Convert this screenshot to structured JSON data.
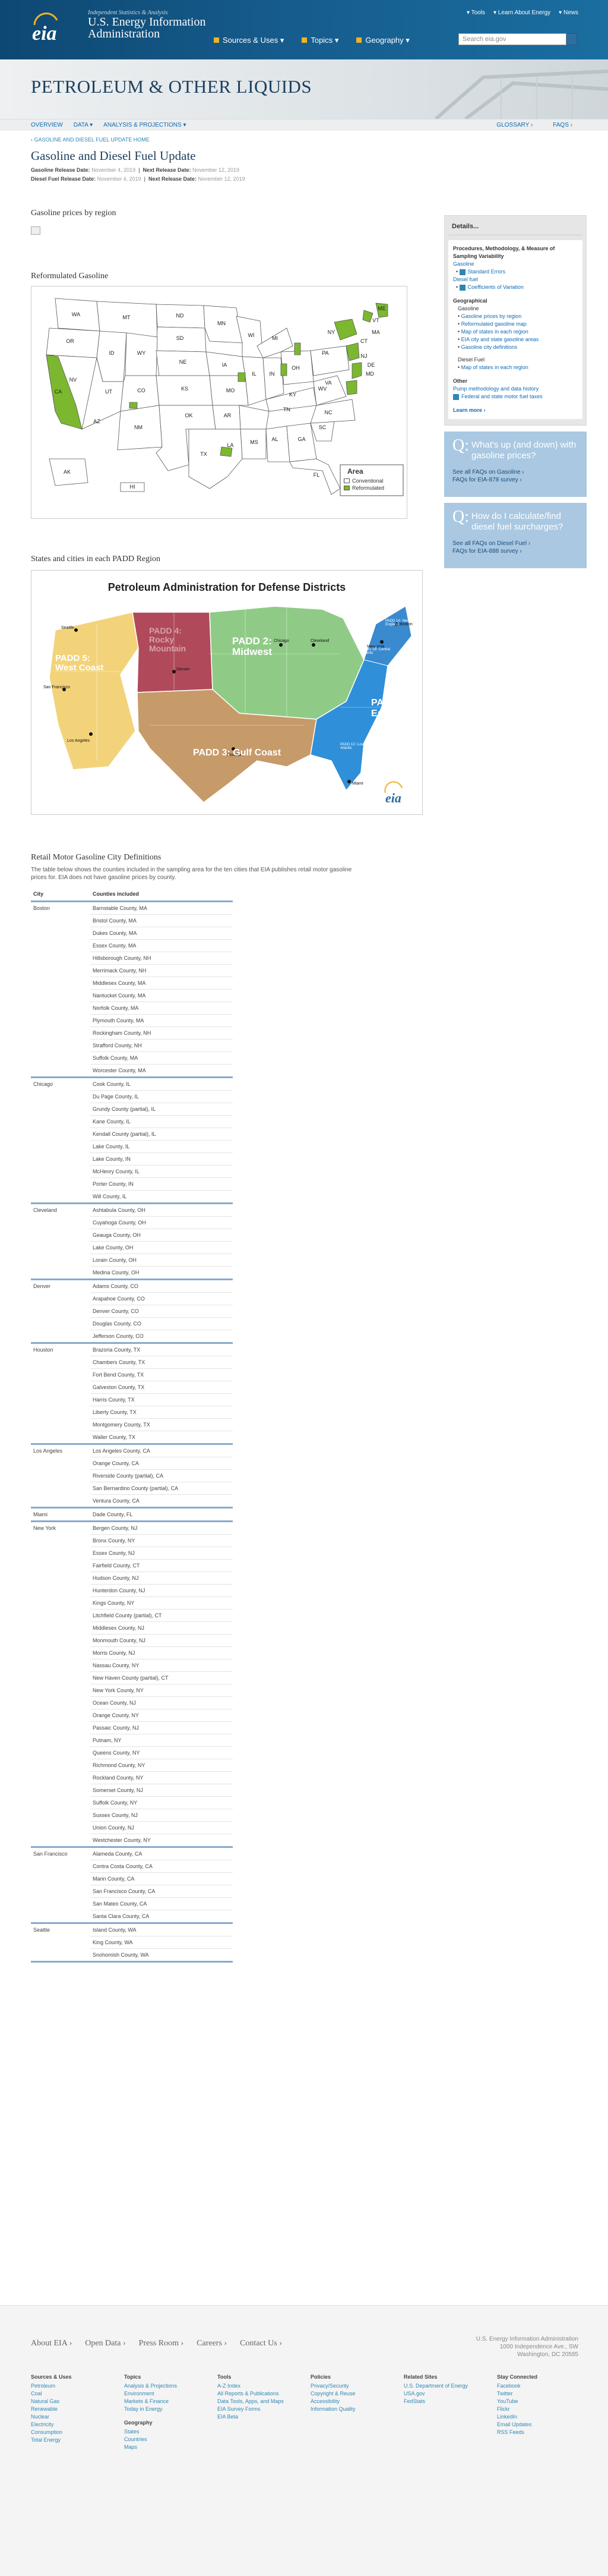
{
  "header": {
    "logo_text": "eia",
    "tagline": "Independent Statistics & Analysis",
    "org_line1": "U.S. Energy Information",
    "org_line2": "Administration",
    "top_links": [
      "Tools",
      "Learn About Energy",
      "News"
    ],
    "nav": [
      "Sources & Uses",
      "Topics",
      "Geography"
    ],
    "search_placeholder": "Search eia.gov"
  },
  "band": {
    "title": "PETROLEUM & OTHER LIQUIDS"
  },
  "subnav": {
    "left": [
      "OVERVIEW",
      "DATA",
      "ANALYSIS & PROJECTIONS"
    ],
    "right": [
      "GLOSSARY",
      "FAQS"
    ]
  },
  "page": {
    "breadcrumb": "‹ GASOLINE AND DIESEL FUEL UPDATE HOME",
    "title": "Gasoline and Diesel Fuel Update",
    "rel1_label": "Gasoline Release Date:",
    "rel1_val": "November 4, 2019",
    "rel1_next_label": "Next Release Date:",
    "rel1_next_val": "November 12, 2019",
    "rel2_label": "Diesel Fuel Release Date:",
    "rel2_val": "November 4, 2019",
    "rel2_next_label": "Next Release Date:",
    "rel2_next_val": "November 12, 2019",
    "sec1": "Gasoline prices by region",
    "sec2": "Reformulated Gasoline",
    "sec3": "States and cities in each PADD Region",
    "sec4": "Retail Motor Gasoline City Definitions",
    "sec4_desc": "The table below shows the counties included in the sampling area for the ten cities that EIA publishes retail motor gasoline prices for. EIA does not have gasoline prices by county."
  },
  "rfg_map": {
    "legend_title": "Area",
    "legend_conv": "Conventional",
    "legend_rfg": "Reformulated",
    "states": [
      "WA",
      "MT",
      "ND",
      "MN",
      "OR",
      "ID",
      "SD",
      "WI",
      "MI",
      "NY",
      "VT",
      "ME",
      "WY",
      "NE",
      "IA",
      "PA",
      "NV",
      "UT",
      "CO",
      "KS",
      "MO",
      "IL",
      "IN",
      "OH",
      "CA",
      "AZ",
      "NM",
      "OK",
      "AR",
      "TN",
      "KY",
      "WV",
      "VA",
      "NC",
      "TX",
      "LA",
      "MS",
      "AL",
      "GA",
      "SC",
      "FL",
      "AK",
      "HI",
      "NH",
      "MA",
      "CT",
      "RI",
      "NJ",
      "DE",
      "MD",
      "DC"
    ]
  },
  "padd_map": {
    "title": "Petroleum Administration for Defense Districts",
    "p1": "PADD 1:",
    "p1b": "East Coast",
    "p1a": "PADD 1A: New England",
    "p1bz": "PADD 1B: Central Atlantic",
    "p1c": "PADD 1C: Lower Atlantic",
    "p2": "PADD 2:",
    "p2b": "Midwest",
    "p3": "PADD 3: Gulf Coast",
    "p4": "PADD 4:",
    "p4b": "Rocky",
    "p4c": "Mountain",
    "p5": "PADD 5:",
    "p5b": "West Coast",
    "logo": "eia",
    "cities": [
      "San Francisco",
      "Los Angeles",
      "Seattle",
      "Denver",
      "Chicago",
      "Cleveland",
      "Boston",
      "New York",
      "Houston",
      "Miami"
    ]
  },
  "table": {
    "headers": [
      "City",
      "Counties included"
    ],
    "rows": [
      {
        "city": "Boston",
        "counties": [
          "Barnstable County, MA",
          "Bristol County, MA",
          "Dukes County, MA",
          "Essex County, MA",
          "Hillsborough County, NH",
          "Merrimack County, NH",
          "Middlesex County, MA",
          "Nantucket County, MA",
          "Norfolk County, MA",
          "Plymouth County, MA",
          "Rockingham County, NH",
          "Strafford County, NH",
          "Suffolk County, MA",
          "Worcester County, MA"
        ]
      },
      {
        "city": "Chicago",
        "counties": [
          "Cook County, IL",
          "Du Page County, IL",
          "Grundy County (partial), IL",
          "Kane County, IL",
          "Kendall County (partial), IL",
          "Lake County, IL",
          "Lake County, IN",
          "McHenry County, IL",
          "Porter County, IN",
          "Will County, IL"
        ]
      },
      {
        "city": "Cleveland",
        "counties": [
          "Ashtabula County, OH",
          "Cuyahoga County, OH",
          "Geauga County, OH",
          "Lake County, OH",
          "Lorain County, OH",
          "Medina County, OH"
        ]
      },
      {
        "city": "Denver",
        "counties": [
          "Adams County, CO",
          "Arapahoe County, CO",
          "Denver County, CO",
          "Douglas County, CO",
          "Jefferson County, CO"
        ]
      },
      {
        "city": "Houston",
        "counties": [
          "Brazoria County, TX",
          "Chambers County, TX",
          "Fort Bend County, TX",
          "Galveston County, TX",
          "Harris County, TX",
          "Liberty County, TX",
          "Montgomery County, TX",
          "Waller County, TX"
        ]
      },
      {
        "city": "Los Angeles",
        "counties": [
          "Los Angeles County, CA",
          "Orange County, CA",
          "Riverside County (partial), CA",
          "San Bernardino County (partial), CA",
          "Ventura County, CA"
        ]
      },
      {
        "city": "Miami",
        "counties": [
          "Dade County, FL"
        ]
      },
      {
        "city": "New York",
        "counties": [
          "Bergen County, NJ",
          "Bronx County, NY",
          "Essex County, NJ",
          "Fairfield County, CT",
          "Hudson County, NJ",
          "Hunterdon County, NJ",
          "Kings County, NY",
          "Litchfield County (partial), CT",
          "Middlesex County, NJ",
          "Monmouth County, NJ",
          "Morris County, NJ",
          "Nassau County, NY",
          "New Haven County (partial), CT",
          "New York County, NY",
          "Ocean County, NJ",
          "Orange County, NY",
          "Passaic County, NJ",
          "Putnam, NY",
          "Queens County, NY",
          "Richmond County, NY",
          "Rockland County, NY",
          "Somerset County, NJ",
          "Suffolk County, NY",
          "Sussex County, NJ",
          "Union County, NJ",
          "Westchester County, NY"
        ]
      },
      {
        "city": "San Francisco",
        "counties": [
          "Alameda County, CA",
          "Contra Costa County, CA",
          "Marin County, CA",
          "San Francisco County, CA",
          "San Mateo County, CA",
          "Santa Clara County, CA"
        ]
      },
      {
        "city": "Seattle",
        "counties": [
          "Island County, WA",
          "King County, WA",
          "Snohomish County, WA"
        ]
      }
    ]
  },
  "sidebar": {
    "details_title": "Details...",
    "pm_title": "Procedures, Methodology, & Measure of Sampling Variability",
    "gasoline": "Gasoline",
    "g_items": [
      "Standard Errors"
    ],
    "diesel": "Diesel fuel",
    "d_items": [
      "Coefficients of Variation"
    ],
    "geo_title": "Geographical",
    "geo_gas": "Gasoline",
    "geo_items": [
      "Gasoline prices by region",
      "Reformulated gasoline map",
      "Map of states in each region",
      "EIA city and state gasoline areas",
      "Gasoline city definitions"
    ],
    "geo_diesel": "Diesel Fuel",
    "geo_d_items": [
      "Map of states in each region"
    ],
    "other": "Other",
    "other_items": [
      "Pump methodology and data history",
      "Federal and state motor fuel taxes"
    ],
    "learn_more": "Learn more ›",
    "faq1_q": "What's up (and down) with gasoline prices?",
    "faq1_l1": "See all FAQs on Gasoline ›",
    "faq1_l2": "FAQs for EIA-878 survey ›",
    "faq2_q": "How do I calculate/find diesel fuel surcharges?",
    "faq2_l1": "See all FAQs on Diesel Fuel ›",
    "faq2_l2": "FAQs for EIA-888 survey ›",
    "faq_mark": "Q:"
  },
  "footer": {
    "nav": [
      "About EIA",
      "Open Data",
      "Press Room",
      "Careers",
      "Contact Us"
    ],
    "addr1": "U.S. Energy Information Administration",
    "addr2": "1000 Independence Ave., SW",
    "addr3": "Washington, DC 20585",
    "cols": [
      {
        "h": "Sources & Uses",
        "items": [
          "Petroleum",
          "Coal",
          "Natural Gas",
          "Renewable",
          "Nuclear",
          "Electricity",
          "Consumption",
          "Total Energy"
        ]
      },
      {
        "h": "Topics",
        "items": [
          "Analysis & Projections",
          "Environment",
          "Markets & Finance",
          "Today in Energy"
        ],
        "h2": "Geography",
        "items2": [
          "States",
          "Countries",
          "Maps"
        ]
      },
      {
        "h": "Tools",
        "items": [
          "A-Z Index",
          "All Reports & Publications",
          "Data Tools, Apps, and Maps",
          "EIA Survey Forms",
          "EIA Beta"
        ]
      },
      {
        "h": "Policies",
        "items": [
          "Privacy/Security",
          "Copyright & Reuse",
          "Accessibility",
          "Information Quality"
        ]
      },
      {
        "h": "Related Sites",
        "items": [
          "U.S. Department of Energy",
          "USA.gov",
          "FedStats"
        ]
      },
      {
        "h": "Stay Connected",
        "items": [
          "Facebook",
          "Twitter",
          "YouTube",
          "Flickr",
          "LinkedIn",
          "Email Updates",
          "RSS Feeds"
        ]
      }
    ]
  },
  "colors": {
    "header": "#165d8e",
    "accent": "#f0b323",
    "rfg_green": "#7cb82f",
    "padd1": "#2f8fd8",
    "padd2": "#8fcb86",
    "padd3": "#c79a6a",
    "padd4": "#b04a5a",
    "padd5": "#f3d37a"
  }
}
